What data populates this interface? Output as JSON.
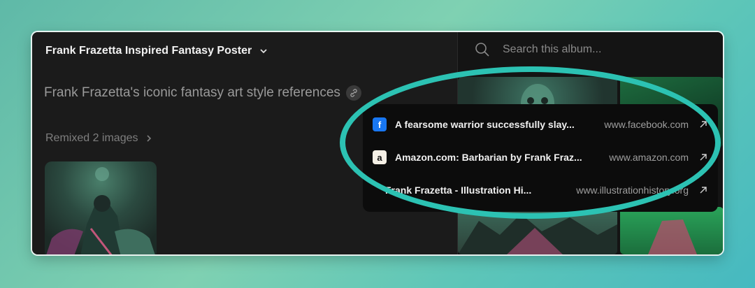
{
  "album": {
    "title": "Frank Frazetta Inspired Fantasy Poster",
    "description": "Frank Frazetta's iconic fantasy art style references",
    "remixed_label": "Remixed 2 images"
  },
  "search": {
    "placeholder": "Search this album..."
  },
  "sources": [
    {
      "icon": "facebook-icon",
      "title": "A fearsome warrior successfully slay...",
      "domain": "www.facebook.com"
    },
    {
      "icon": "amazon-icon",
      "title": "Amazon.com: Barbarian by Frank Fraz...",
      "domain": "www.amazon.com"
    },
    {
      "icon": "site-icon",
      "title": "Frank Frazetta - Illustration Hi...",
      "domain": "www.illustrationhistory.org"
    }
  ],
  "colors": {
    "highlight_ellipse": "#2cc2b3",
    "facebook_blue": "#1877f2",
    "background_gradient": "#5fb9a8"
  }
}
